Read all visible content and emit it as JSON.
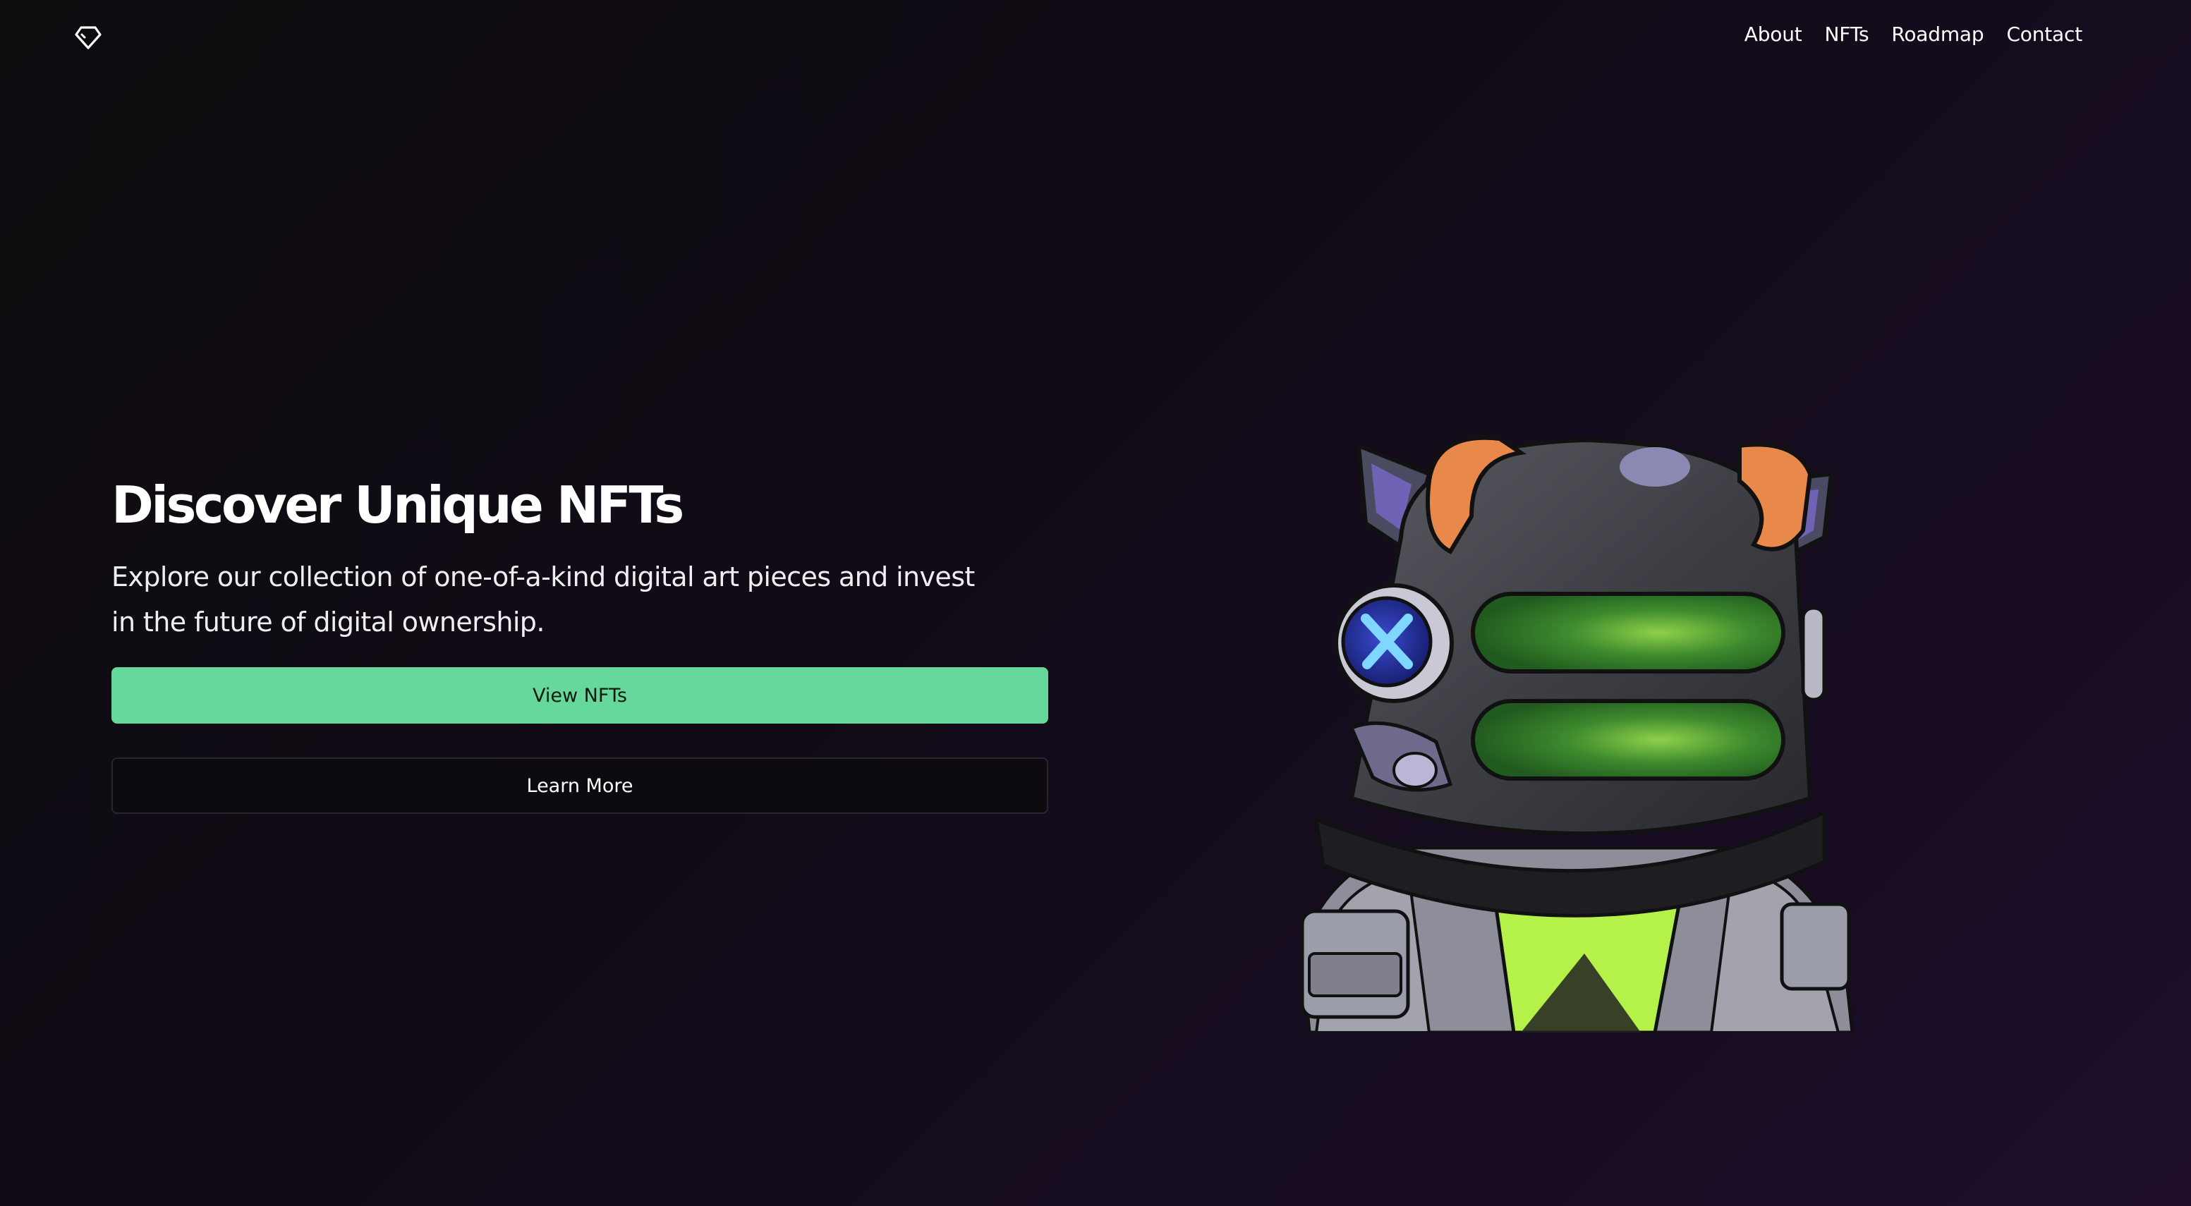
{
  "header": {
    "logo_icon": "diamond-icon",
    "nav": [
      {
        "label": "About"
      },
      {
        "label": "NFTs"
      },
      {
        "label": "Roadmap"
      },
      {
        "label": "Contact"
      }
    ]
  },
  "hero": {
    "title": "Discover Unique NFTs",
    "subtitle": "Explore our collection of one-of-a-kind digital art pieces and invest in the future of digital ownership.",
    "primary_button": "View NFTs",
    "secondary_button": "Learn More",
    "accent_color": "#66d89b"
  }
}
